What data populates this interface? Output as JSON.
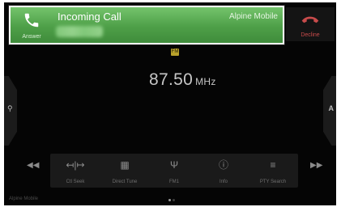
{
  "call": {
    "title": "Incoming Call",
    "caller_name": "Alpine Mobile",
    "answer_label": "Answer",
    "decline_label": "Decline"
  },
  "radio": {
    "band_badge": "FM",
    "frequency": "87.50",
    "unit": "MHz"
  },
  "side": {
    "left_icon": "search-icon",
    "right_label": "A"
  },
  "transport": {
    "prev_icon": "previous-track-icon",
    "next_icon": "next-track-icon"
  },
  "functions": [
    {
      "label": "Ctl Seek",
      "icon": "seek-icon"
    },
    {
      "label": "Direct Tune",
      "icon": "keypad-icon"
    },
    {
      "label": "FM1",
      "icon": "antenna-icon"
    },
    {
      "label": "Info",
      "icon": "info-icon"
    },
    {
      "label": "PTY Search",
      "icon": "list-search-icon"
    }
  ],
  "footer": {
    "text": "Alpine Mobile"
  },
  "colors": {
    "banner_green": "#4e9f48",
    "decline_red": "#c84b4b",
    "badge_gold": "#b8a12b"
  }
}
